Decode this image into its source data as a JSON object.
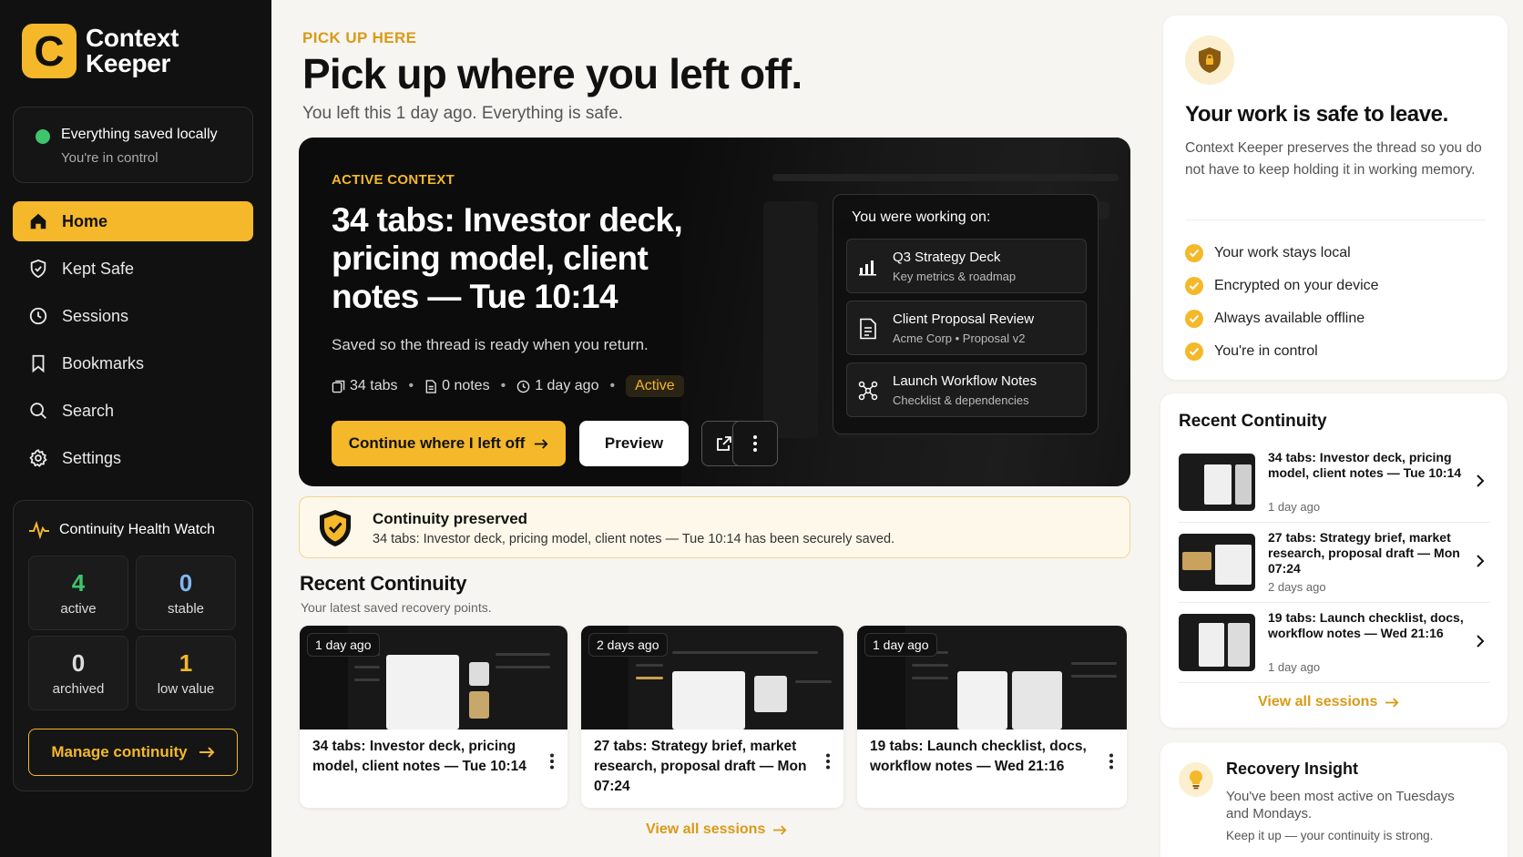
{
  "app": {
    "logo_letter": "C",
    "name_line1": "Context",
    "name_line2": "Keeper",
    "accent_color": "#f4b82a"
  },
  "sidebar": {
    "saved_status": {
      "title": "Everything saved locally",
      "subtitle": "You're in control",
      "status_color": "#3ec56b"
    },
    "nav": [
      {
        "label": "Home",
        "icon": "home-icon",
        "active": true
      },
      {
        "label": "Kept Safe",
        "icon": "shield-icon",
        "active": false
      },
      {
        "label": "Sessions",
        "icon": "clock-icon",
        "active": false
      },
      {
        "label": "Bookmarks",
        "icon": "bookmark-icon",
        "active": false
      },
      {
        "label": "Search",
        "icon": "search-icon",
        "active": false
      },
      {
        "label": "Settings",
        "icon": "gear-icon",
        "active": false
      }
    ],
    "health": {
      "title": "Continuity Health Watch",
      "stats": [
        {
          "value": "4",
          "label": "active",
          "color": "#3ec56b"
        },
        {
          "value": "0",
          "label": "stable",
          "color": "#7fb8f0"
        },
        {
          "value": "0",
          "label": "archived",
          "color": "#dddddd"
        },
        {
          "value": "1",
          "label": "low value",
          "color": "#f4b82a"
        }
      ],
      "manage_label": "Manage continuity"
    }
  },
  "main": {
    "eyebrow": "PICK UP HERE",
    "title": "Pick up where you left off.",
    "subtitle": "You left this 1 day ago. Everything is safe.",
    "hero": {
      "eyebrow": "ACTIVE CONTEXT",
      "title": "34 tabs: Investor deck, pricing model, client notes — Tue 10:14",
      "description": "Saved so the thread is ready when you return.",
      "meta": {
        "tabs": "34 tabs",
        "notes": "0 notes",
        "ago": "1 day ago",
        "status": "Active"
      },
      "continue_label": "Continue where I left off",
      "preview_label": "Preview",
      "working": {
        "title": "You were working on:",
        "items": [
          {
            "title": "Q3 Strategy Deck",
            "subtitle": "Key metrics & roadmap",
            "icon": "bar-chart-icon"
          },
          {
            "title": "Client Proposal Review",
            "subtitle": "Acme Corp • Proposal v2",
            "icon": "document-icon"
          },
          {
            "title": "Launch Workflow Notes",
            "subtitle": "Checklist & dependencies",
            "icon": "workflow-icon"
          }
        ]
      }
    },
    "preserved": {
      "title": "Continuity preserved",
      "message": "34 tabs: Investor deck, pricing model, client notes — Tue 10:14 has been securely saved."
    },
    "recent": {
      "title": "Recent Continuity",
      "subtitle": "Your latest saved recovery points.",
      "cards": [
        {
          "badge": "1 day ago",
          "title": "34 tabs: Investor deck, pricing model, client notes — Tue 10:14"
        },
        {
          "badge": "2 days ago",
          "title": "27 tabs: Strategy brief, market research, proposal draft — Mon 07:24"
        },
        {
          "badge": "1 day ago",
          "title": "19 tabs: Launch checklist, docs, workflow notes — Wed 21:16"
        }
      ],
      "view_all": "View all sessions"
    }
  },
  "right": {
    "safe": {
      "title": "Your work is safe to leave.",
      "description": "Context Keeper preserves the thread so you do not have to keep holding it in working memory.",
      "checks": [
        "Your work stays local",
        "Encrypted on your device",
        "Always available offline",
        "You're in control"
      ]
    },
    "recent": {
      "title": "Recent Continuity",
      "items": [
        {
          "title": "34 tabs: Investor deck, pricing model, client notes — Tue 10:14",
          "ago": "1 day ago"
        },
        {
          "title": "27 tabs: Strategy brief, market research, proposal draft — Mon 07:24",
          "ago": "2 days ago"
        },
        {
          "title": "19 tabs: Launch checklist, docs, workflow notes — Wed 21:16",
          "ago": "1 day ago"
        }
      ],
      "view_all": "View all sessions"
    },
    "insight": {
      "title": "Recovery Insight",
      "description": "You've been most active on Tuesdays and Mondays.",
      "footer": "Keep it up — your continuity is strong."
    }
  }
}
